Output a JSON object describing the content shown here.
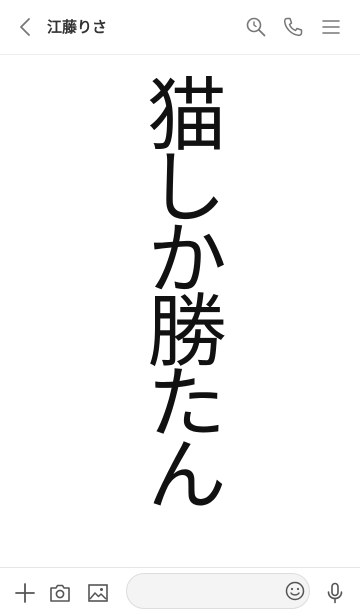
{
  "header": {
    "title": "江藤りさ",
    "icons": [
      "chevron-left-icon",
      "search-icon",
      "phone-icon",
      "menu-icon"
    ]
  },
  "message": {
    "text": "猫しか勝たん"
  },
  "footer": {
    "input_value": "",
    "icons": [
      "plus-icon",
      "camera-icon",
      "image-icon",
      "emoji-icon",
      "microphone-icon"
    ]
  },
  "colors": {
    "icon": "#777777",
    "title": "#333333",
    "text": "#111111",
    "background": "#ffffff"
  }
}
